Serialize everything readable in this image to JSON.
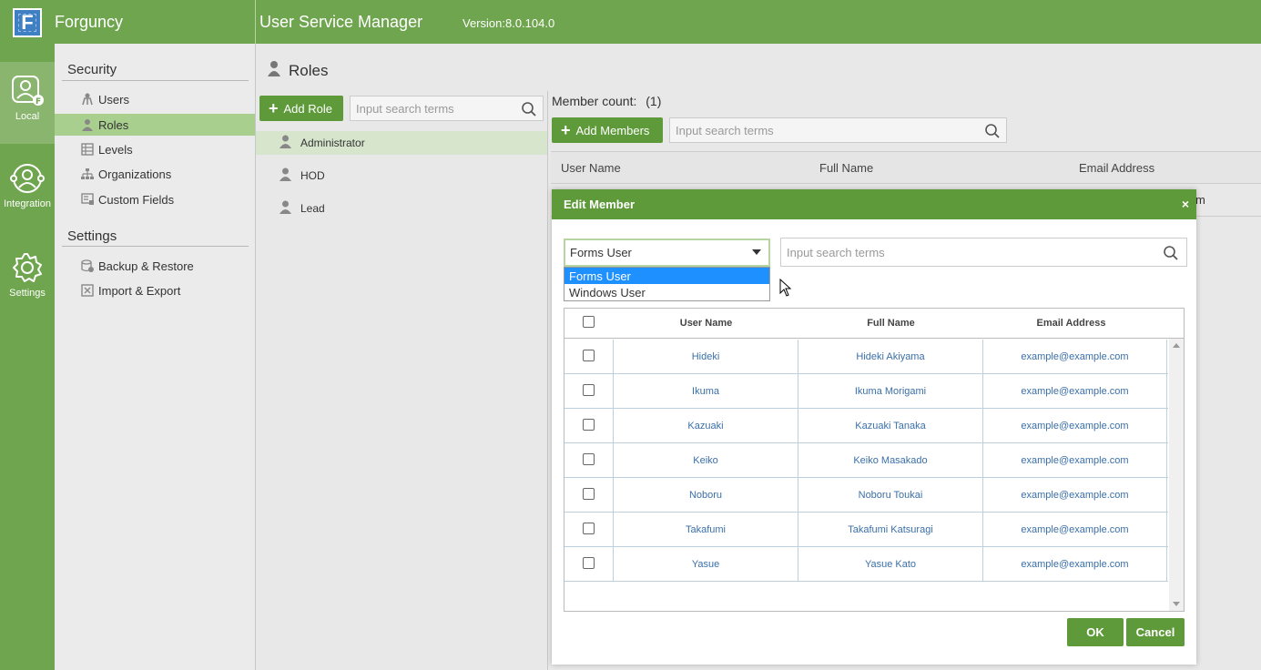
{
  "topbar": {
    "brand": "Forguncy",
    "app_title": "User Service Manager",
    "version": "Version:8.0.104.0"
  },
  "rail": {
    "items": [
      {
        "label": "Local",
        "icon": "local-user-icon"
      },
      {
        "label": "Integration",
        "icon": "integration-icon"
      },
      {
        "label": "Settings",
        "icon": "gear-icon"
      }
    ]
  },
  "nav": {
    "security_heading": "Security",
    "security_items": [
      {
        "label": "Users",
        "icon": "users-icon"
      },
      {
        "label": "Roles",
        "icon": "role-icon"
      },
      {
        "label": "Levels",
        "icon": "levels-icon"
      },
      {
        "label": "Organizations",
        "icon": "organizations-icon"
      },
      {
        "label": "Custom Fields",
        "icon": "custom-fields-icon"
      }
    ],
    "settings_heading": "Settings",
    "settings_items": [
      {
        "label": "Backup & Restore",
        "icon": "backup-icon"
      },
      {
        "label": "Import & Export",
        "icon": "import-export-icon"
      }
    ]
  },
  "roles": {
    "title": "Roles",
    "add_role_label": "Add Role",
    "search_placeholder": "Input search terms",
    "items": [
      "Administrator",
      "HOD",
      "Lead"
    ]
  },
  "members": {
    "count_label": "Member count:",
    "count_value": "(1)",
    "add_members_label": "Add Members",
    "search_placeholder": "Input search terms",
    "columns": [
      "User Name",
      "Full Name",
      "Email Address"
    ],
    "partial_cell": "m"
  },
  "modal": {
    "title": "Edit Member",
    "close_glyph": "×",
    "select_value": "Forms User",
    "options": [
      "Forms User",
      "Windows User"
    ],
    "search_placeholder": "Input search terms",
    "columns": [
      "User Name",
      "Full Name",
      "Email Address"
    ],
    "rows": [
      {
        "user": "Hideki",
        "full": "Hideki Akiyama",
        "email": "example@example.com"
      },
      {
        "user": "Ikuma",
        "full": "Ikuma Morigami",
        "email": "example@example.com"
      },
      {
        "user": "Kazuaki",
        "full": "Kazuaki Tanaka",
        "email": "example@example.com"
      },
      {
        "user": "Keiko",
        "full": "Keiko Masakado",
        "email": "example@example.com"
      },
      {
        "user": "Noboru",
        "full": "Noboru Toukai",
        "email": "example@example.com"
      },
      {
        "user": "Takafumi",
        "full": "Takafumi Katsuragi",
        "email": "example@example.com"
      },
      {
        "user": "Yasue",
        "full": "Yasue Kato",
        "email": "example@example.com"
      }
    ],
    "ok_label": "OK",
    "cancel_label": "Cancel"
  },
  "colors": {
    "brand_green": "#70a550",
    "button_green": "#5e9a3a",
    "active_nav": "#a9cf8e",
    "selected_option": "#1e90ff"
  }
}
